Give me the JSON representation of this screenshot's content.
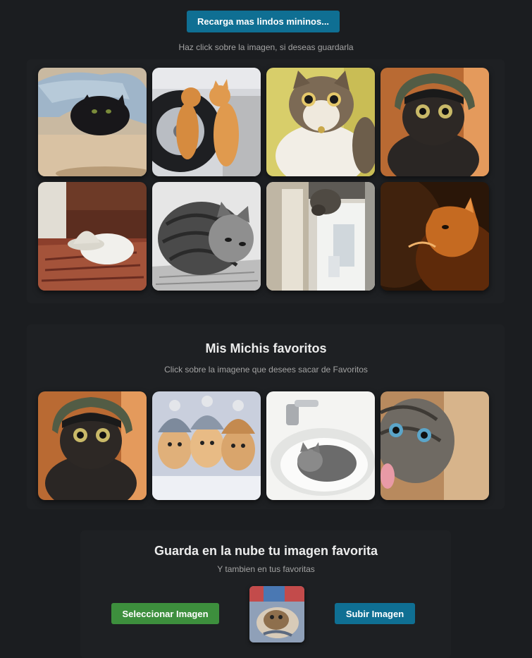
{
  "reload": {
    "label": "Recarga mas lindos mininos..."
  },
  "random": {
    "hint": "Haz click sobre la imagen, si deseas guardarla",
    "images": [
      {
        "icon": "cat-under-blanket-photo"
      },
      {
        "icon": "two-kittens-on-tire-photo"
      },
      {
        "icon": "surprised-cat-photo"
      },
      {
        "icon": "kitten-in-helmet-photo"
      },
      {
        "icon": "white-cat-with-hat-photo"
      },
      {
        "icon": "bw-sleeping-kitten-photo"
      },
      {
        "icon": "cat-on-door-photo"
      },
      {
        "icon": "orange-cat-sunlight-photo"
      }
    ]
  },
  "favorites": {
    "title": "Mis Michis favoritos",
    "hint": "Click sobre la imagene que desees sacar de Favoritos",
    "images": [
      {
        "icon": "kitten-in-helmet-photo"
      },
      {
        "icon": "kittens-in-beanies-photo"
      },
      {
        "icon": "kitten-in-sink-photo"
      },
      {
        "icon": "excited-kitten-photo"
      }
    ]
  },
  "upload": {
    "title": "Guarda en la nube tu imagen favorita",
    "subtitle": "Y tambien en tus favoritas",
    "select_label": "Seleccionar Imagen",
    "upload_label": "Subir Imagen",
    "preview_icon": "upload-preview-photo"
  },
  "colors": {
    "background": "#1b1d20",
    "primary_button": "#0f6f93",
    "select_button": "#3d8f3d"
  }
}
